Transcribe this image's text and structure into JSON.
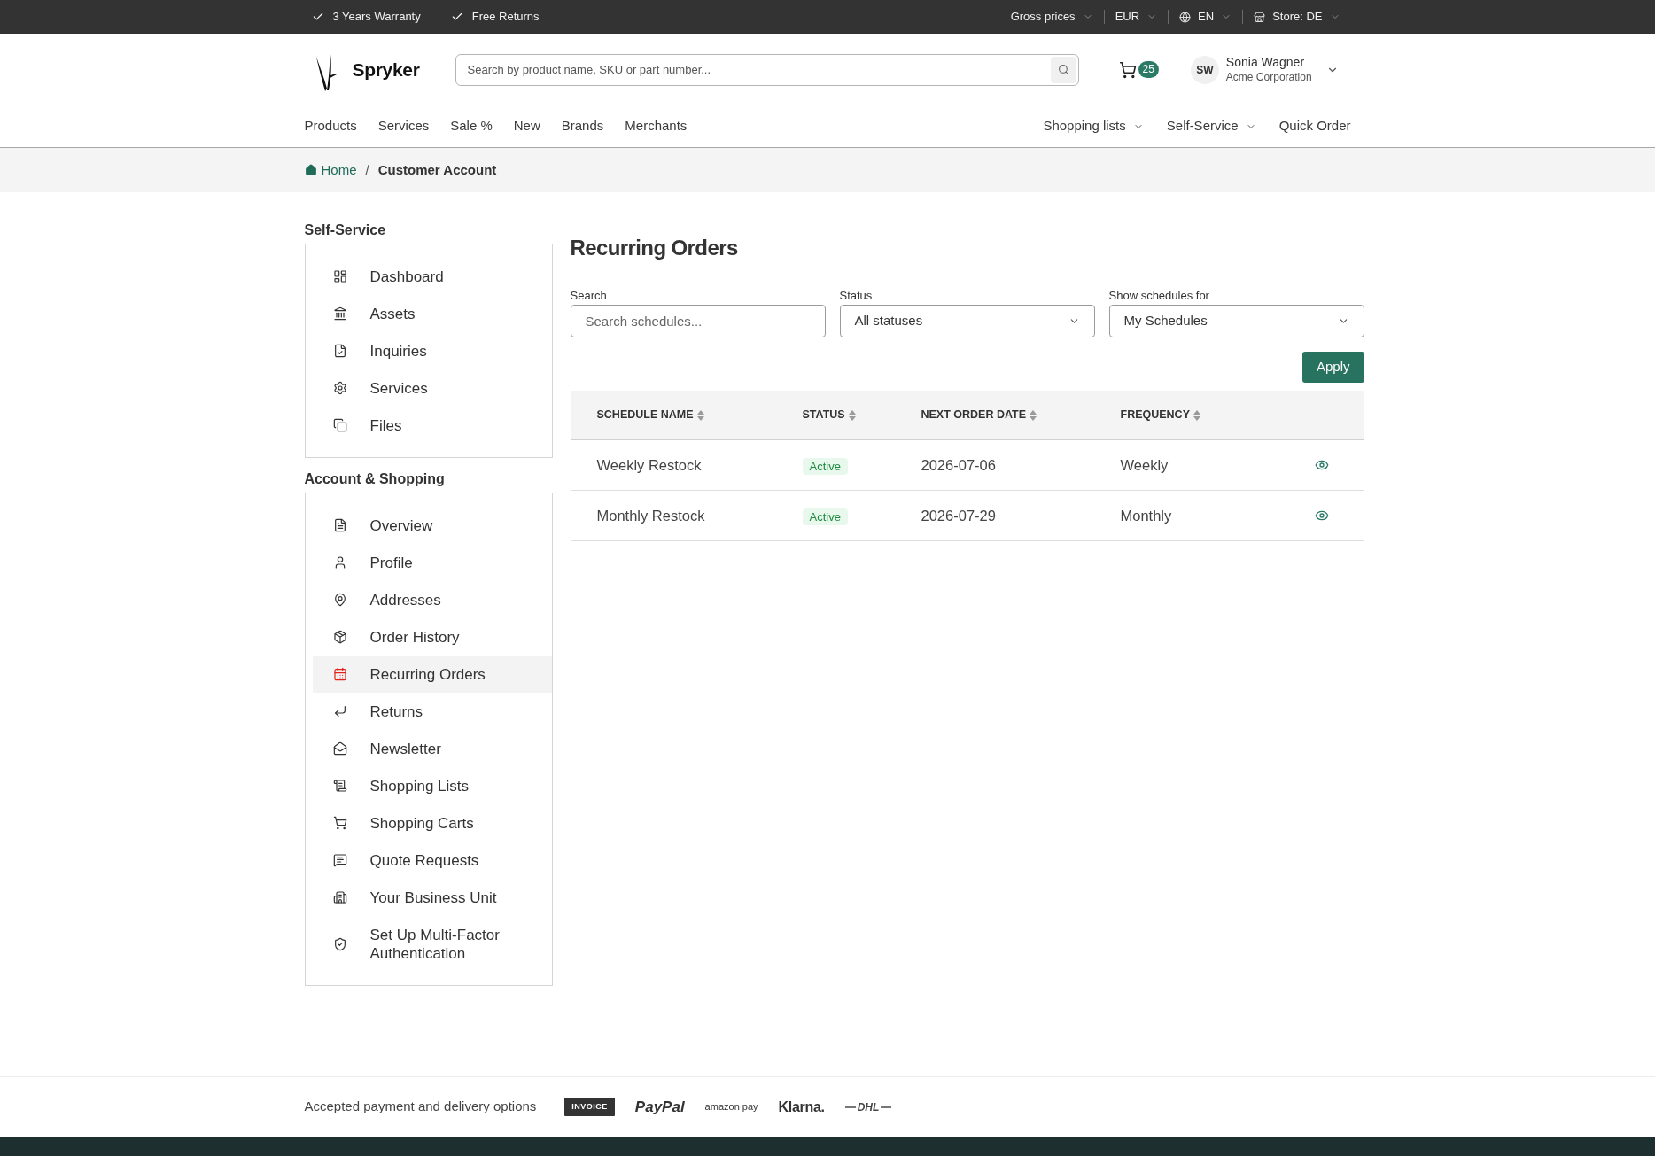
{
  "top_bar": {
    "benefits": [
      "3 Years Warranty",
      "Free Returns"
    ],
    "settings": [
      {
        "label": "Gross prices",
        "kind": "plain"
      },
      {
        "label": "EUR",
        "kind": "plain"
      },
      {
        "label": "EN",
        "kind": "language"
      },
      {
        "label": "Store: DE",
        "kind": "store"
      }
    ]
  },
  "header": {
    "logo": "Spryker",
    "search": {
      "placeholder": "Search by product name, SKU or part number..."
    },
    "cart_count": "25",
    "user": {
      "initials": "SW",
      "name": "Sonia Wagner",
      "company": "Acme Corporation"
    }
  },
  "nav": {
    "main": [
      "Products",
      "Services",
      "Sale %",
      "New",
      "Brands",
      "Merchants"
    ],
    "right": [
      {
        "label": "Shopping lists",
        "kind": "dropdown"
      },
      {
        "label": "Self-Service",
        "kind": "dropdown"
      },
      {
        "label": "Quick Order",
        "kind": "link"
      }
    ]
  },
  "breadcrumb": [
    {
      "label": "Home",
      "kind": "home"
    },
    {
      "label": "/",
      "kind": "separator"
    },
    {
      "label": "Customer Account",
      "kind": "current"
    }
  ],
  "sidebar": {
    "sections": [
      {
        "title": "Self-Service",
        "items": [
          {
            "label": "Dashboard",
            "selected": false
          },
          {
            "label": "Assets",
            "selected": false
          },
          {
            "label": "Inquiries",
            "selected": false
          },
          {
            "label": "Services",
            "selected": false
          },
          {
            "label": "Files",
            "selected": false
          }
        ]
      },
      {
        "title": "Account & Shopping",
        "items": [
          {
            "label": "Overview",
            "selected": false
          },
          {
            "label": "Profile",
            "selected": false
          },
          {
            "label": "Addresses",
            "selected": false
          },
          {
            "label": "Order History",
            "selected": false
          },
          {
            "label": "Recurring Orders",
            "selected": true
          },
          {
            "label": "Returns",
            "selected": false
          },
          {
            "label": "Newsletter",
            "selected": false
          },
          {
            "label": "Shopping Lists",
            "selected": false
          },
          {
            "label": "Shopping Carts",
            "selected": false
          },
          {
            "label": "Quote Requests",
            "selected": false
          },
          {
            "label": "Your Business Unit",
            "selected": false
          },
          {
            "label": "Set Up Multi-Factor Authentication",
            "selected": false
          }
        ]
      }
    ]
  },
  "page": {
    "title": "Recurring Orders",
    "filters": [
      {
        "label": "Search",
        "kind": "input",
        "placeholder": "Search schedules..."
      },
      {
        "label": "Status",
        "kind": "select",
        "value": "All statuses"
      },
      {
        "label": "Show schedules for",
        "kind": "select",
        "value": "My Schedules"
      }
    ],
    "apply_button": "Apply"
  },
  "table": {
    "columns": [
      "SCHEDULE NAME",
      "STATUS",
      "NEXT ORDER DATE",
      "FREQUENCY"
    ],
    "rows": [
      {
        "name": "Weekly Restock",
        "status": "Active",
        "next_order_date": "2026-07-06",
        "frequency": "Weekly"
      },
      {
        "name": "Monthly Restock",
        "status": "Active",
        "next_order_date": "2026-07-29",
        "frequency": "Monthly"
      }
    ]
  },
  "footer": {
    "text": "Accepted payment and delivery options",
    "logos": [
      {
        "label": "INVOICE",
        "kind": "badge"
      },
      {
        "label": "PayPal",
        "kind": "italic"
      },
      {
        "label": "amazon pay",
        "kind": "small"
      },
      {
        "label": "Klarna.",
        "kind": "bold"
      },
      {
        "label": "DHL",
        "kind": "striped"
      }
    ]
  }
}
